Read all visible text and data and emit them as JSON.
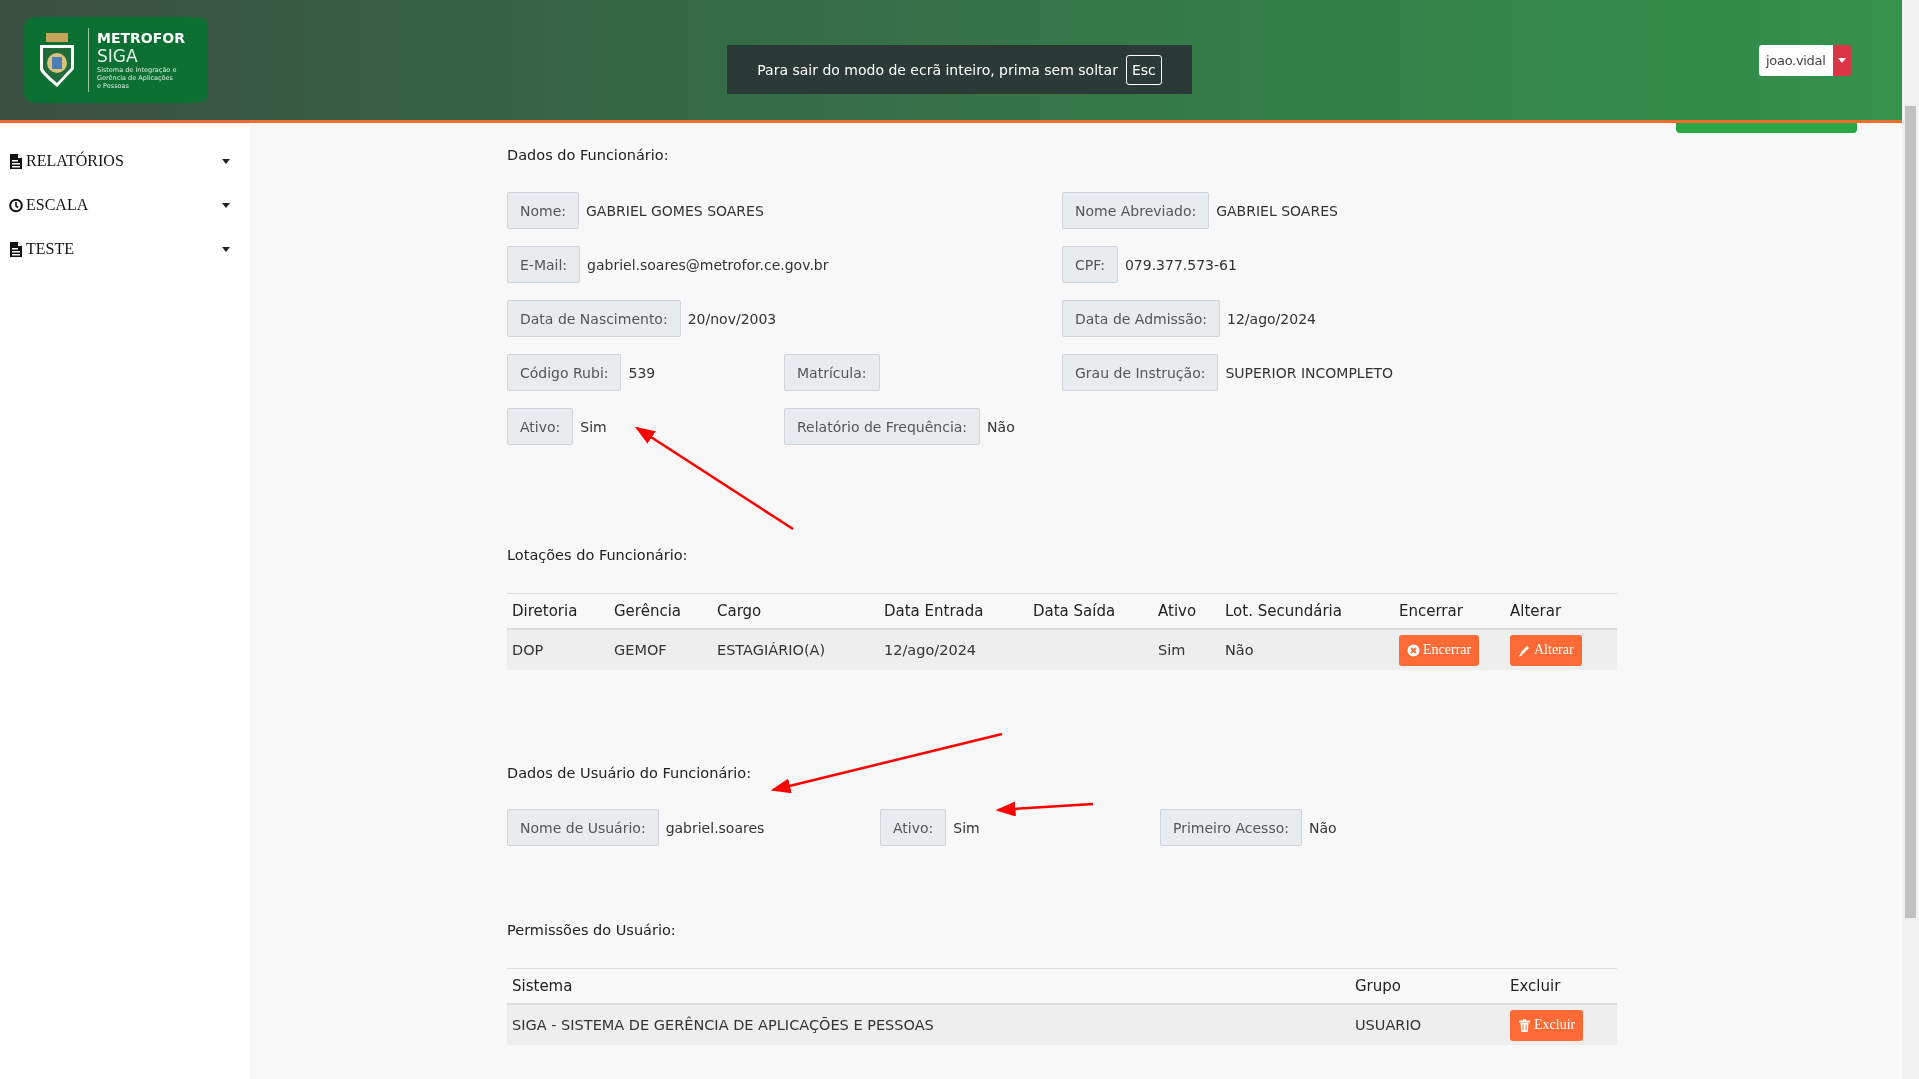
{
  "header": {
    "logo": {
      "brand": "METROFOR",
      "product": "SIGA",
      "tagline": [
        "Sistema de Integração e",
        "Gerência de Aplicações",
        "e Pessoas"
      ]
    },
    "fullscreen_notice": {
      "text": "Para sair do modo de ecrã inteiro, prima sem soltar",
      "key": "Esc"
    },
    "user_menu": {
      "username": "joao.vidal"
    }
  },
  "sidebar": {
    "items": [
      {
        "label": "RELATÓRIOS",
        "kind": "document"
      },
      {
        "label": "ESCALA",
        "kind": "clock"
      },
      {
        "label": "TESTE",
        "kind": "document"
      }
    ]
  },
  "employee_data": {
    "title": "Dados do Funcionário:",
    "rows": [
      [
        {
          "label": "Nome:",
          "value": "GABRIEL GOMES SOARES"
        },
        null,
        {
          "label": "Nome Abreviado:",
          "value": "GABRIEL SOARES"
        }
      ],
      [
        {
          "label": "E-Mail:",
          "value": "gabriel.soares@metrofor.ce.gov.br"
        },
        null,
        {
          "label": "CPF:",
          "value": "079.377.573-61"
        }
      ],
      [
        {
          "label": "Data de Nascimento:",
          "value": "20/nov/2003"
        },
        null,
        {
          "label": "Data de Admissão:",
          "value": "12/ago/2024"
        }
      ],
      [
        {
          "label": "Código Rubi:",
          "value": "539"
        },
        {
          "label": "Matrícula:"
        },
        {
          "label": "Grau de Instrução:",
          "value": "SUPERIOR INCOMPLETO"
        }
      ],
      [
        {
          "label": "Ativo:",
          "value": "Sim"
        },
        {
          "label": "Relatório de Frequência:",
          "value": "Não"
        },
        null
      ]
    ]
  },
  "assignments": {
    "title": "Lotações do Funcionário:",
    "columns": [
      "Diretoria",
      "Gerência",
      "Cargo",
      "Data Entrada",
      "Data Saída",
      "Ativo",
      "Lot. Secundária",
      "Encerrar",
      "Alterar"
    ],
    "rows": [
      {
        "cells": [
          "DOP",
          "GEMOF",
          "ESTAGIÁRIO(A)",
          "12/ago/2024",
          "",
          "Sim",
          "Não"
        ],
        "buttons": [
          {
            "label": "Encerrar",
            "kind": "close"
          },
          {
            "label": "Alterar",
            "kind": "edit"
          }
        ]
      }
    ]
  },
  "user_data": {
    "title": "Dados de Usuário do Funcionário:",
    "rows": [
      [
        {
          "label": "Nome de Usuário:",
          "value": "gabriel.soares"
        },
        {
          "label": "Ativo:",
          "value": "Sim"
        },
        {
          "label": "Primeiro Acesso:",
          "value": "Não"
        }
      ]
    ]
  },
  "permissions": {
    "title": "Permissões do Usuário:",
    "columns": [
      "Sistema",
      "Grupo",
      "Excluir"
    ],
    "rows": [
      {
        "cells": [
          "SIGA - SISTEMA DE GERÊNCIA DE APLICAÇÕES E PESSOAS",
          "USUARIO"
        ],
        "buttons": [
          {
            "label": "Excluir",
            "kind": "delete"
          }
        ]
      }
    ]
  }
}
